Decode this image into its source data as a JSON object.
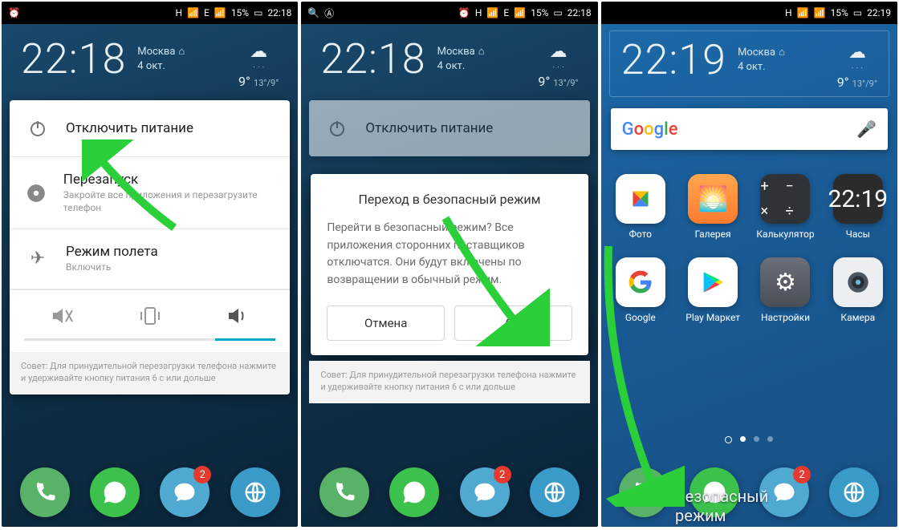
{
  "status": {
    "net_label": "H",
    "signal1_label": "sig1",
    "net2_label": "E",
    "signal2_label": "sig2",
    "wifi": "wifi",
    "battery_pct": "15%",
    "time_a": "22:18",
    "time_c": "22:19"
  },
  "clock": {
    "time_a": "22:18",
    "time_c": "22:19",
    "city": "Москва",
    "date": "4 окт.",
    "temp_main": "9",
    "temp_range": "13°/9°"
  },
  "power_menu": {
    "power_off": "Отключить питание",
    "restart_title": "Перезапуск",
    "restart_sub": "Закройте все приложения и перезагрузите телефон",
    "airplane_title": "Режим полета",
    "airplane_sub": "Включить",
    "tip": "Совет: Для принудительной перезагрузки телефона нажмите и удерживайте кнопку питания 6 с или дольше"
  },
  "dialog": {
    "title": "Переход в безопасный режим",
    "body": "Перейти в безопасный режим? Все приложения сторонних поставщиков отключатся. Они будут включены по возвращении в обычный режим.",
    "cancel": "Отмена",
    "ok": "OK"
  },
  "google": {
    "label": "Google"
  },
  "apps": {
    "photo": "Фото",
    "gallery": "Галерея",
    "calculator": "Калькулятор",
    "clock": "Часы",
    "clock_time": "22:19",
    "google": "Google",
    "play": "Play Маркет",
    "settings": "Настройки",
    "camera": "Камера"
  },
  "dock": {
    "msg_badge": "2"
  },
  "safemode_label": "Безопасный режим"
}
